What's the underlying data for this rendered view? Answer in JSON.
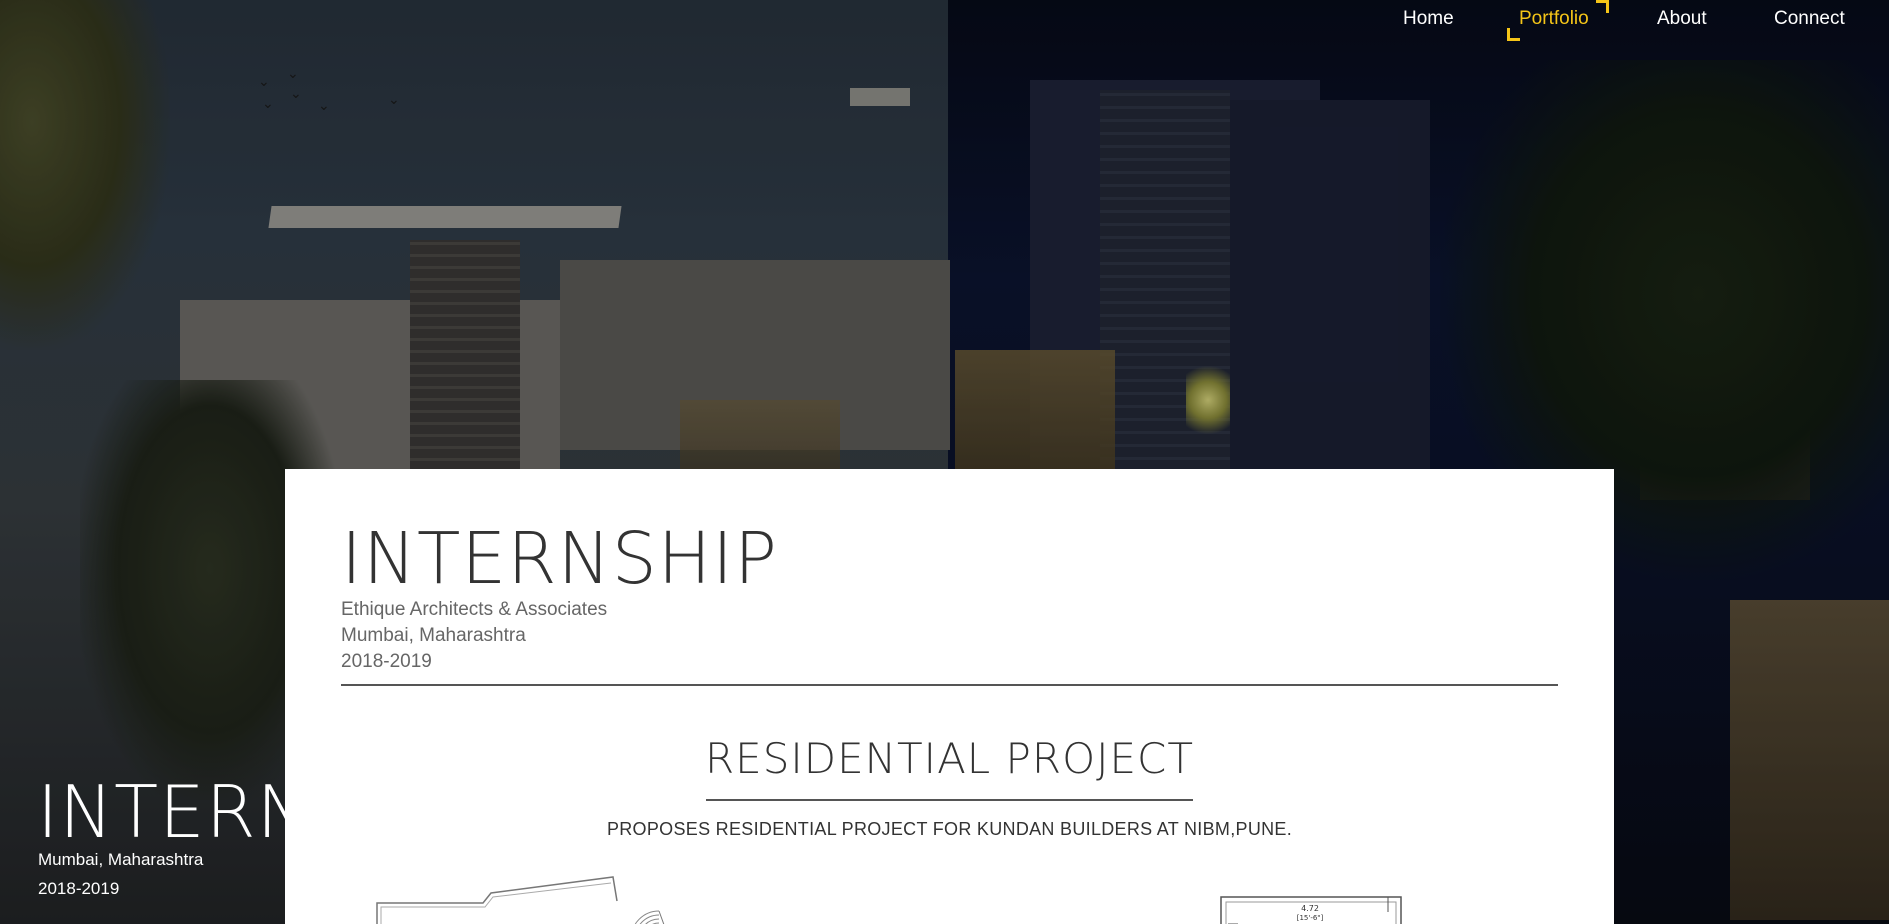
{
  "nav": {
    "items": [
      {
        "label": "Home",
        "active": false
      },
      {
        "label": "Portfolio",
        "active": true
      },
      {
        "label": "About",
        "active": false
      },
      {
        "label": "Connect",
        "active": false
      }
    ],
    "active_color": "#f5c518"
  },
  "hero": {
    "title": "INTERNSHIP",
    "location": "Mumbai, Maharashtra",
    "years": "2018-2019"
  },
  "card": {
    "title": "INTERNSHIP",
    "company": "Ethique Architects & Associates",
    "location": "Mumbai, Maharashtra",
    "years": "2018-2019",
    "section_title": "RESIDENTIAL PROJECT",
    "section_description": "PROPOSES RESIDENTIAL PROJECT FOR KUNDAN BUILDERS AT NIBM,PUNE.",
    "plan_label_metric": "4.72",
    "plan_label_imperial": "[15'-6\"]"
  }
}
